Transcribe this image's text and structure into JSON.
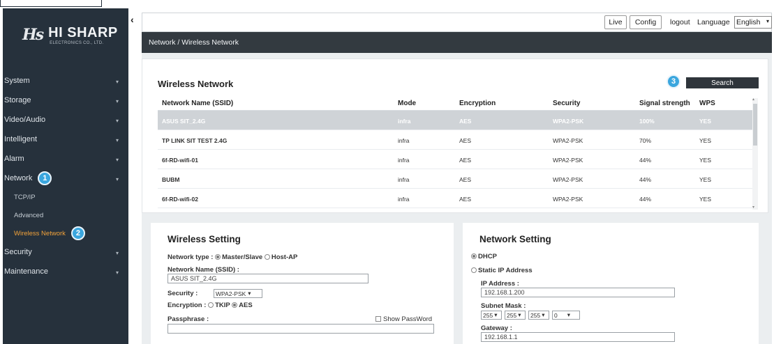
{
  "brand": {
    "mark": "Hs",
    "name": "HI SHARP",
    "sub": "ELECTRONICS CO., LTD."
  },
  "sidebar": {
    "collapse_glyph": "‹",
    "items": [
      {
        "label": "System",
        "chev": "▾"
      },
      {
        "label": "Storage",
        "chev": "▾"
      },
      {
        "label": "Video/Audio",
        "chev": "▾"
      },
      {
        "label": "Intelligent",
        "chev": "▾"
      },
      {
        "label": "Alarm",
        "chev": "▾"
      },
      {
        "label": "Network",
        "chev": "▾",
        "badge": "1"
      },
      {
        "label": "Security",
        "chev": "▾"
      },
      {
        "label": "Maintenance",
        "chev": "▾"
      }
    ],
    "network_sub": [
      {
        "label": "TCP/IP"
      },
      {
        "label": "Advanced"
      },
      {
        "label": "Wireless Network",
        "badge": "2"
      }
    ]
  },
  "topbar": {
    "live": "Live",
    "config": "Config",
    "logout": "logout",
    "language_label": "Language",
    "language_value": "English",
    "caret": "▾"
  },
  "breadcrumb": "Network / Wireless Network",
  "wireless_network": {
    "title": "Wireless Network",
    "search": "Search",
    "badge": "3",
    "columns": {
      "ssid": "Network Name (SSID)",
      "mode": "Mode",
      "encryption": "Encryption",
      "security": "Security",
      "signal": "Signal strength",
      "wps": "WPS"
    },
    "rows": [
      {
        "ssid": "ASUS SIT_2.4G",
        "mode": "infra",
        "encryption": "AES",
        "security": "WPA2-PSK",
        "signal": "100%",
        "wps": "YES"
      },
      {
        "ssid": "TP LINK SIT TEST 2.4G",
        "mode": "infra",
        "encryption": "AES",
        "security": "WPA2-PSK",
        "signal": "70%",
        "wps": "YES"
      },
      {
        "ssid": "6f-RD-wifi-01",
        "mode": "infra",
        "encryption": "AES",
        "security": "WPA2-PSK",
        "signal": "44%",
        "wps": "YES"
      },
      {
        "ssid": "BUBM",
        "mode": "infra",
        "encryption": "AES",
        "security": "WPA2-PSK",
        "signal": "44%",
        "wps": "YES"
      },
      {
        "ssid": "6f-RD-wifi-02",
        "mode": "infra",
        "encryption": "AES",
        "security": "WPA2-PSK",
        "signal": "44%",
        "wps": "YES"
      }
    ],
    "scroll_up": "▴",
    "scroll_down": "▾"
  },
  "wireless_setting": {
    "title": "Wireless Setting",
    "network_type_label": "Network type :",
    "master_slave": "Master/Slave",
    "host_ap": "Host-AP",
    "ssid_label": "Network Name (SSID) :",
    "ssid_value": "ASUS SIT_2.4G",
    "security_label": "Security :",
    "security_value": "WPA2-PSK",
    "encryption_label": "Encryption :",
    "tkip": "TKIP",
    "aes": "AES",
    "passphrase_label": "Passphrase :",
    "passphrase_value": "",
    "show_password": "Show PassWord",
    "caret": "▾"
  },
  "network_setting": {
    "title": "Network Setting",
    "dhcp": "DHCP",
    "static_ip": "Static IP Address",
    "ip_label": "IP Address :",
    "ip_value": "192.168.1.200",
    "subnet_label": "Subnet Mask :",
    "subnet_values": [
      "255",
      "255",
      "255",
      "0"
    ],
    "gateway_label": "Gateway :",
    "gateway_value": "192.168.1.1",
    "caret": "▾"
  }
}
